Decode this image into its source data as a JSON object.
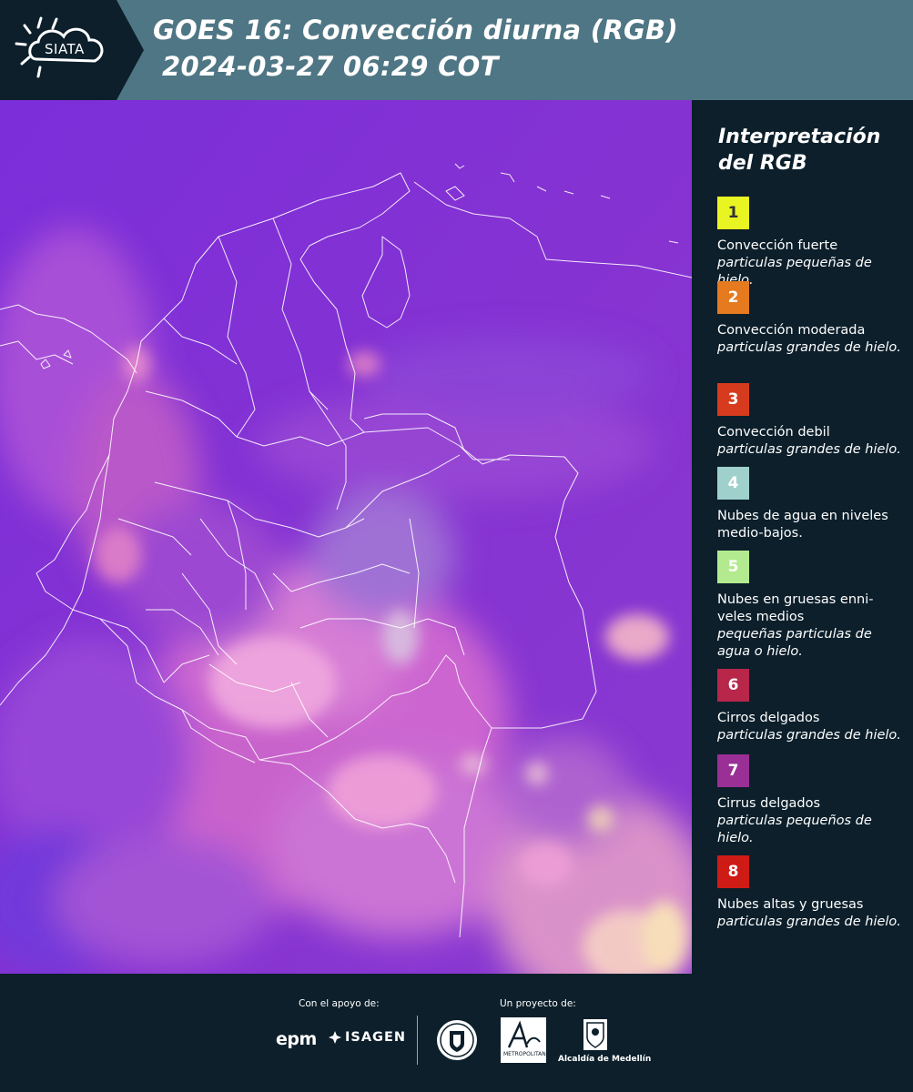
{
  "header": {
    "logo_text": "SIATA",
    "title_line1": "GOES 16: Convección diurna (RGB)",
    "title_line2": "2024-03-27 06:29 COT"
  },
  "legend": {
    "title_line1": "Interpretación",
    "title_line2": "del RGB",
    "items": [
      {
        "number": "1",
        "color": "#e8f522",
        "text_color": "#333333",
        "main": "Convección fuerte",
        "sub": "particulas pequeñas de hielo."
      },
      {
        "number": "2",
        "color": "#e57a1f",
        "text_color": "#ffffff",
        "main": "Convección moderada",
        "sub": "particulas grandes de hielo."
      },
      {
        "number": "3",
        "color": "#d63b1d",
        "text_color": "#ffffff",
        "main": "Convección debil",
        "sub": "particulas grandes de hielo."
      },
      {
        "number": "4",
        "color": "#9fd0cc",
        "text_color": "#ffffff",
        "main": "Nubes de agua en niveles medio-bajos.",
        "sub": ""
      },
      {
        "number": "5",
        "color": "#b3ea8f",
        "text_color": "#ffffff",
        "main": "Nubes en gruesas enni-veles medios",
        "sub": "pequeñas particulas de agua o hielo."
      },
      {
        "number": "6",
        "color": "#b8264a",
        "text_color": "#ffffff",
        "main": "Cirros delgados",
        "sub": "particulas grandes de hielo."
      },
      {
        "number": "7",
        "color": "#9a2f96",
        "text_color": "#ffffff",
        "main": "Cirrus delgados",
        "sub": "particulas pequeños de hielo."
      },
      {
        "number": "8",
        "color": "#cf1b15",
        "text_color": "#ffffff",
        "main": "Nubes altas y gruesas",
        "sub": "particulas grandes de hielo."
      }
    ]
  },
  "footer": {
    "support_label": "Con el apoyo de:",
    "project_label": "Un proyecto de:",
    "sponsor1": "epm",
    "sponsor2": "ISAGEN",
    "partner1_label": "METROPOLITANA Valle de Aburrá",
    "partner2_label": "Alcaldía de Medellín"
  },
  "colors": {
    "header_bg": "#4f7684",
    "logo_band": "#0c1f2b",
    "panel_bg": "#0c1f2b",
    "map_base": "#7a2fd6"
  }
}
